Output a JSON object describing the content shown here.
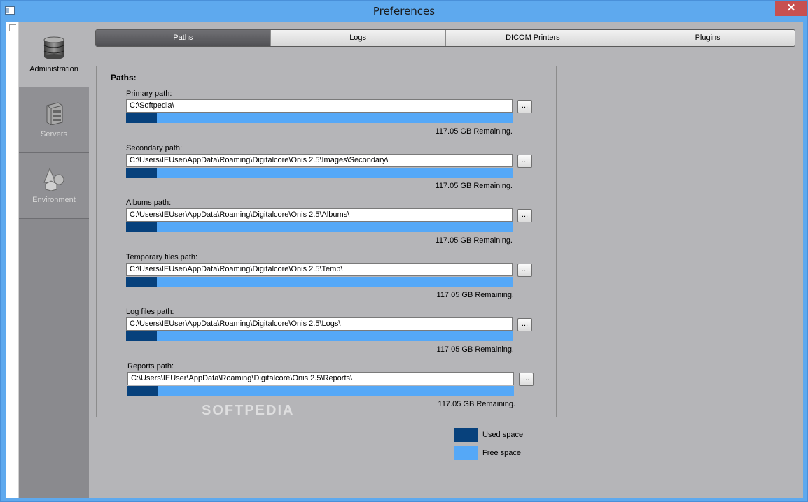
{
  "window": {
    "title": "Preferences",
    "close_glyph": "✕"
  },
  "sidebar": {
    "items": [
      {
        "label": "Administration",
        "icon": "database-icon"
      },
      {
        "label": "Servers",
        "icon": "server-icon"
      },
      {
        "label": "Environment",
        "icon": "shapes-icon"
      }
    ]
  },
  "tabs": [
    {
      "label": "Paths"
    },
    {
      "label": "Logs"
    },
    {
      "label": "DICOM Printers"
    },
    {
      "label": "Plugins"
    }
  ],
  "paths": {
    "group_title": "Paths:",
    "browse_label": "...",
    "entries": [
      {
        "label": "Primary path:",
        "value": "C:\\Softpedia\\",
        "remaining": "117.05 GB Remaining.",
        "used_fraction": 0.08
      },
      {
        "label": "Secondary path:",
        "value": "C:\\Users\\IEUser\\AppData\\Roaming\\Digitalcore\\Onis 2.5\\Images\\Secondary\\",
        "remaining": "117.05 GB Remaining.",
        "used_fraction": 0.08
      },
      {
        "label": "Albums path:",
        "value": "C:\\Users\\IEUser\\AppData\\Roaming\\Digitalcore\\Onis 2.5\\Albums\\",
        "remaining": "117.05 GB Remaining.",
        "used_fraction": 0.08
      },
      {
        "label": "Temporary files path:",
        "value": "C:\\Users\\IEUser\\AppData\\Roaming\\Digitalcore\\Onis 2.5\\Temp\\",
        "remaining": "117.05 GB Remaining.",
        "used_fraction": 0.08
      },
      {
        "label": "Log files path:",
        "value": "C:\\Users\\IEUser\\AppData\\Roaming\\Digitalcore\\Onis 2.5\\Logs\\",
        "remaining": "117.05 GB Remaining.",
        "used_fraction": 0.08
      },
      {
        "label": "Reports path:",
        "value": "C:\\Users\\IEUser\\AppData\\Roaming\\Digitalcore\\Onis 2.5\\Reports\\",
        "remaining": "117.05 GB Remaining.",
        "used_fraction": 0.08
      }
    ]
  },
  "legend": {
    "used_label": "Used space",
    "free_label": "Free space",
    "used_color": "#07417c",
    "free_color": "#55a8f7"
  },
  "watermark": "SOFTPEDIA"
}
